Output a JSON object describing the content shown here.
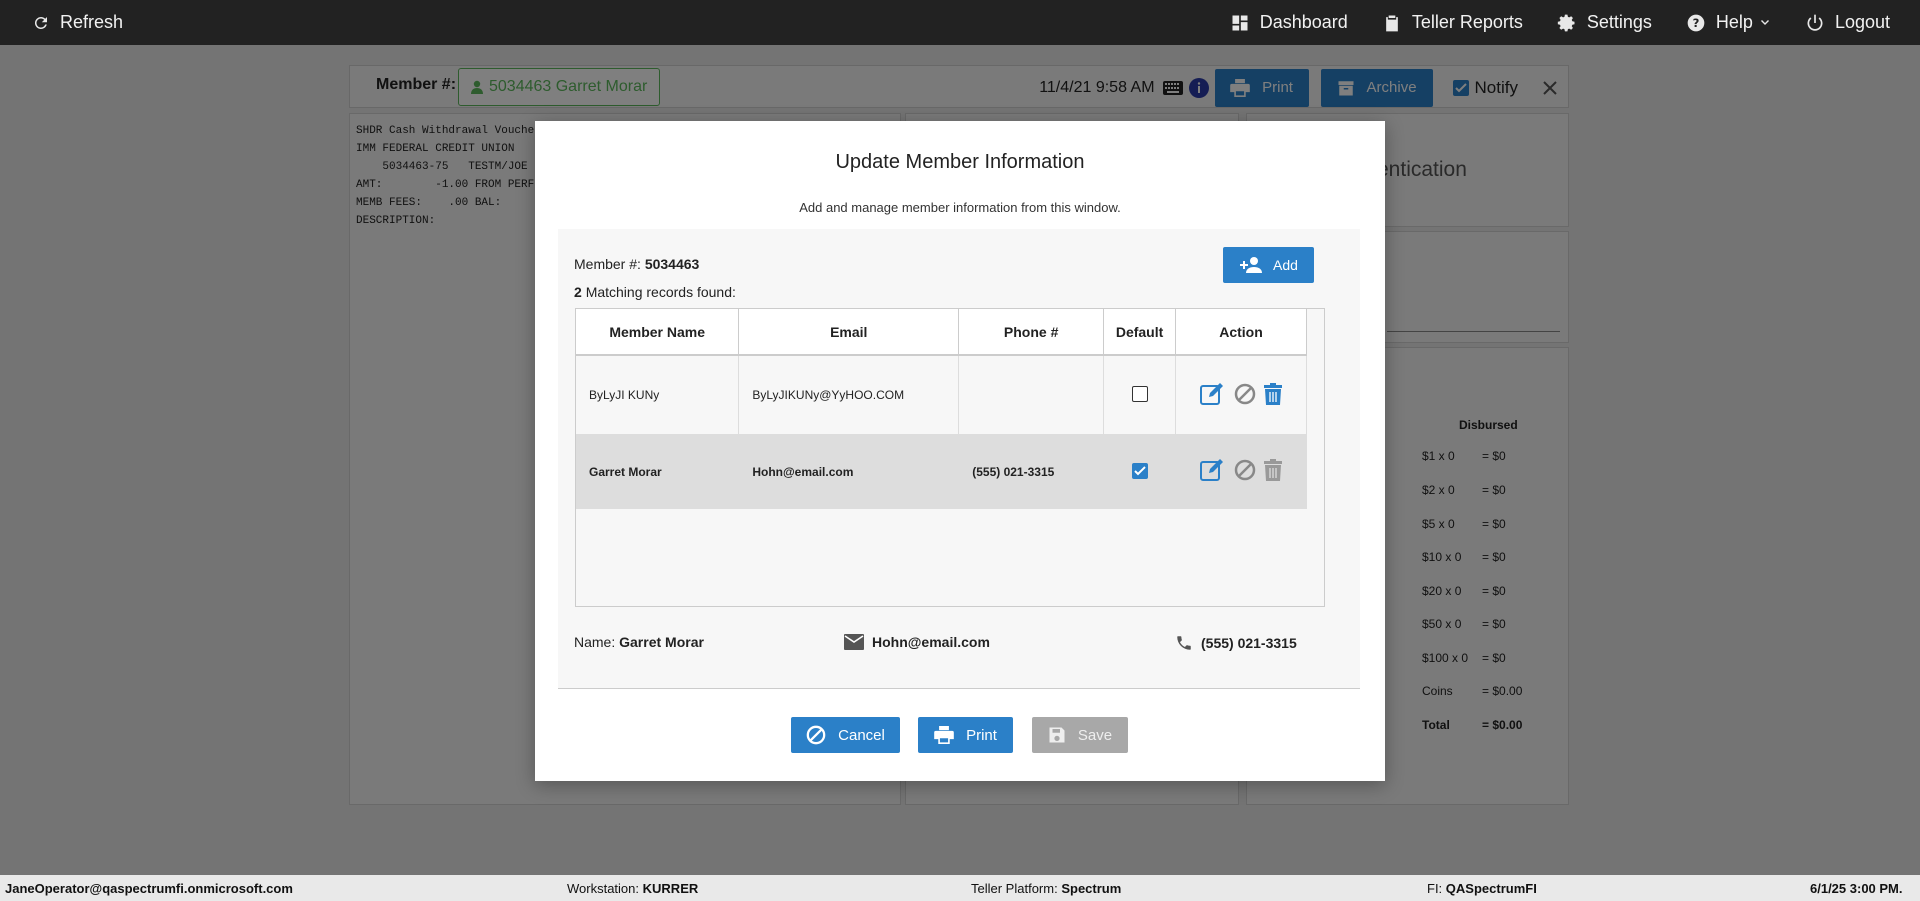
{
  "topbar": {
    "refresh": "Refresh",
    "dashboard": "Dashboard",
    "teller_reports": "Teller Reports",
    "settings": "Settings",
    "help": "Help",
    "logout": "Logout"
  },
  "member_bar": {
    "label": "Member #:",
    "member": "5034463 Garret Morar",
    "datetime": "11/4/21 9:58 AM",
    "print": "Print",
    "archive": "Archive",
    "notify": "Notify"
  },
  "receipt": {
    "lines": [
      "SHDR Cash Withdrawal Vouche",
      "IMM FEDERAL CREDIT UNION",
      "    5034463-75   TESTM/JOE",
      "AMT:        -1.00 FROM PERF",
      "MEMB FEES:    .00 BAL:",
      "DESCRIPTION:"
    ]
  },
  "auth_panel": {
    "text": "entication"
  },
  "disbursed": {
    "header": "Disbursed",
    "rows": [
      {
        "d": "$1 x 0",
        "v": "= $0"
      },
      {
        "d": "$2 x 0",
        "v": "= $0"
      },
      {
        "d": "$5 x 0",
        "v": "= $0"
      },
      {
        "d": "$10 x 0",
        "v": "= $0"
      },
      {
        "d": "$20 x 0",
        "v": "= $0"
      },
      {
        "d": "$50 x 0",
        "v": "= $0"
      },
      {
        "d": "$100 x 0",
        "v": "= $0"
      },
      {
        "d": "Coins",
        "v": "= $0.00"
      },
      {
        "d": "Total",
        "v": "= $0.00"
      }
    ]
  },
  "modal": {
    "title": "Update Member Information",
    "subtitle": "Add and manage member information from this window.",
    "member_label": "Member #:",
    "member_number": "5034463",
    "matching_count": "2",
    "matching_text": "Matching records found:",
    "add": "Add",
    "columns": [
      "Member Name",
      "Email",
      "Phone #",
      "Default",
      "Action"
    ],
    "rows": [
      {
        "name": "ByLyJI KUNy",
        "email": "ByLyJIKUNy@YyHOO.COM",
        "phone": "",
        "default": false
      },
      {
        "name": "Garret Morar",
        "email": "Hohn@email.com",
        "phone": "(555) 021-3315",
        "default": true
      }
    ],
    "summary": {
      "name_label": "Name:",
      "name": "Garret Morar",
      "email": "Hohn@email.com",
      "phone": "(555) 021-3315"
    },
    "cancel": "Cancel",
    "print": "Print",
    "save": "Save"
  },
  "footer": {
    "user": "JaneOperator@qaspectrumfi.onmicrosoft.com",
    "workstation_label": "Workstation:",
    "workstation": "KURRER",
    "platform_label": "Teller Platform:",
    "platform": "Spectrum",
    "fi_label": "FI:",
    "fi": "QASpectrumFI",
    "datetime": "6/1/25 3:00 PM."
  }
}
